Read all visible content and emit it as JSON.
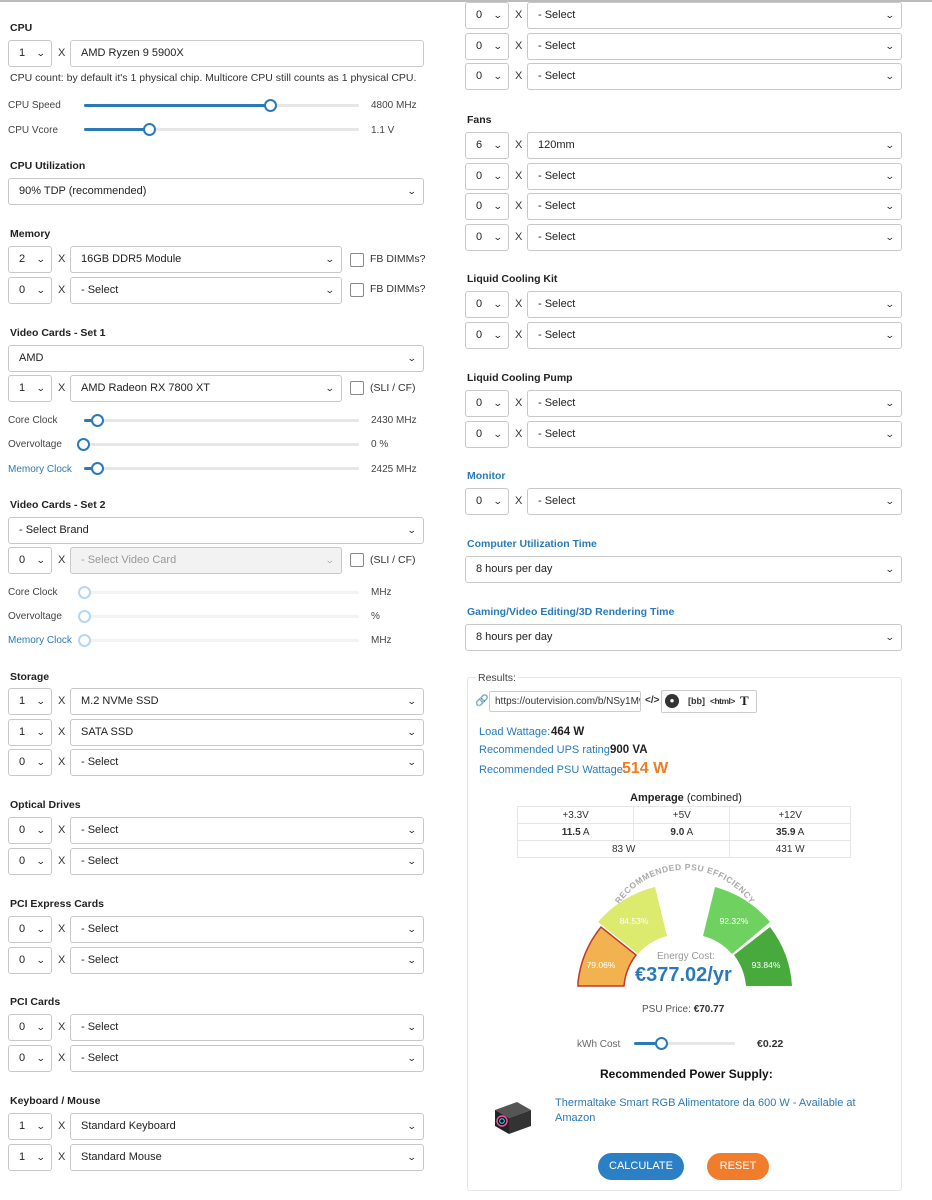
{
  "cpu": {
    "title": "CPU",
    "qty": "1",
    "model": "AMD Ryzen 9 5900X",
    "note": "CPU count: by default it's 1 physical chip. Multicore CPU still counts as 1 physical CPU.",
    "speed_label": "CPU Speed",
    "speed_value": "4800 MHz",
    "speed_level": 0.68,
    "vcore_label": "CPU Vcore",
    "vcore_value": "1.1 V",
    "vcore_level": 0.24
  },
  "cpu_util": {
    "title": "CPU Utilization",
    "value": "90% TDP (recommended)"
  },
  "memory": {
    "title": "Memory",
    "rows": [
      {
        "qty": "2",
        "value": "16GB DDR5 Module",
        "cb": "FB DIMMs?"
      },
      {
        "qty": "0",
        "value": "- Select",
        "cb": "FB DIMMs?"
      }
    ]
  },
  "vc1": {
    "title": "Video Cards - Set 1",
    "brand": "AMD",
    "qty": "1",
    "card": "AMD Radeon RX 7800 XT",
    "cb": "(SLI / CF)",
    "core_label": "Core Clock",
    "core_value": "2430 MHz",
    "core_level": 0.05,
    "ov_label": "Overvoltage",
    "ov_value": "0 %",
    "ov_level": 0.0,
    "mem_label": "Memory Clock",
    "mem_value": "2425 MHz",
    "mem_level": 0.05
  },
  "vc2": {
    "title": "Video Cards - Set 2",
    "brand": "- Select Brand",
    "qty": "0",
    "card": "- Select Video Card",
    "cb": "(SLI / CF)",
    "core_label": "Core Clock",
    "core_value": "MHz",
    "ov_label": "Overvoltage",
    "ov_value": "%",
    "mem_label": "Memory Clock",
    "mem_value": "MHz"
  },
  "storage": {
    "title": "Storage",
    "rows": [
      {
        "qty": "1",
        "value": "M.2 NVMe SSD"
      },
      {
        "qty": "1",
        "value": "SATA SSD"
      },
      {
        "qty": "0",
        "value": "- Select"
      }
    ]
  },
  "optical": {
    "title": "Optical Drives",
    "rows": [
      {
        "qty": "0",
        "value": "- Select"
      },
      {
        "qty": "0",
        "value": "- Select"
      }
    ]
  },
  "pcie": {
    "title": "PCI Express Cards",
    "rows": [
      {
        "qty": "0",
        "value": "- Select"
      },
      {
        "qty": "0",
        "value": "- Select"
      }
    ]
  },
  "pci": {
    "title": "PCI Cards",
    "rows": [
      {
        "qty": "0",
        "value": "- Select"
      },
      {
        "qty": "0",
        "value": "- Select"
      }
    ]
  },
  "kbm": {
    "title": "Keyboard / Mouse",
    "rows": [
      {
        "qty": "1",
        "value": "Standard Keyboard"
      },
      {
        "qty": "1",
        "value": "Standard Mouse"
      }
    ]
  },
  "top_rows": [
    {
      "qty": "0",
      "value": "- Select"
    },
    {
      "qty": "0",
      "value": "- Select"
    },
    {
      "qty": "0",
      "value": "- Select"
    }
  ],
  "fans": {
    "title": "Fans",
    "rows": [
      {
        "qty": "6",
        "value": "120mm"
      },
      {
        "qty": "0",
        "value": "- Select"
      },
      {
        "qty": "0",
        "value": "- Select"
      },
      {
        "qty": "0",
        "value": "- Select"
      }
    ]
  },
  "lck": {
    "title": "Liquid Cooling Kit",
    "rows": [
      {
        "qty": "0",
        "value": "- Select"
      },
      {
        "qty": "0",
        "value": "- Select"
      }
    ]
  },
  "lcp": {
    "title": "Liquid Cooling Pump",
    "rows": [
      {
        "qty": "0",
        "value": "- Select"
      },
      {
        "qty": "0",
        "value": "- Select"
      }
    ]
  },
  "monitor": {
    "title": "Monitor",
    "rows": [
      {
        "qty": "0",
        "value": "- Select"
      }
    ]
  },
  "util_time": {
    "title": "Computer Utilization Time",
    "value": "8 hours per day"
  },
  "gaming_time": {
    "title": "Gaming/Video Editing/3D Rendering Time",
    "value": "8 hours per day"
  },
  "x_sign": "X",
  "results": {
    "label": "Results:",
    "url": "https://outervision.com/b/NSy1Mw",
    "share_icons": [
      "link-icon",
      "code-icon",
      "reddit-icon",
      "bbcode-icon",
      "html-icon",
      "text-icon"
    ],
    "bb": "[bb]",
    "html": "<html>",
    "t": "T",
    "load_label": "Load Wattage:",
    "load_value": "464 W",
    "ups_label": "Recommended UPS rating:",
    "ups_value": "900 VA",
    "psu_label": "Recommended PSU Wattage:",
    "psu_value": "514 W",
    "amp_title": "Amperage",
    "amp_sub": "(combined)",
    "rails": [
      "+3.3V",
      "+5V",
      "+12V"
    ],
    "amps_num": [
      "11.5",
      "9.0",
      "35.9"
    ],
    "amp_unit": "A",
    "watts_a": "83 W",
    "watts_b": "431 W",
    "gauge_title": "RECOMMENDED PSU EFFICIENCY",
    "eff": [
      "79.06%",
      "84.53%",
      "92.32%",
      "93.84%"
    ],
    "energy_label": "Energy Cost:",
    "energy_value": "€377.02/yr",
    "psu_price_label": "PSU Price:",
    "psu_price_value": "€70.77",
    "kwh_label": "kWh Cost",
    "kwh_value": "€0.22",
    "kwh_level": 0.28,
    "rec_title": "Recommended Power Supply:",
    "product": "Thermaltake Smart RGB Alimentatore da 600 W - Available at Amazon",
    "calc": "CALCULATE",
    "reset": "RESET"
  },
  "colors": {
    "blue": "#2a7ab8",
    "orange": "#ef7d22",
    "calc_btn": "#2b80c5",
    "reset_btn": "#f07c2c"
  }
}
